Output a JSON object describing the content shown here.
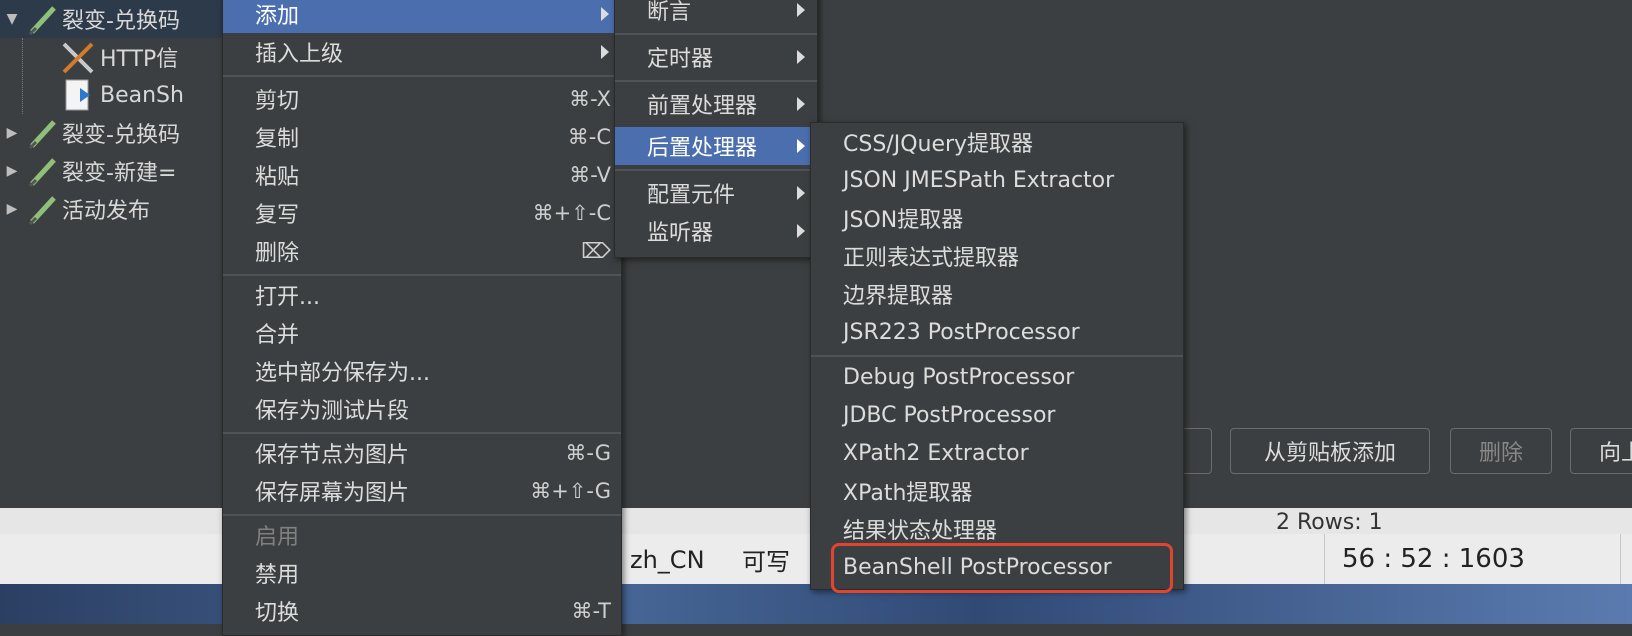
{
  "tree": {
    "items": [
      {
        "label": "裂变-兑换码",
        "expanded": true,
        "selected": true
      },
      {
        "label": "HTTP信",
        "child": true
      },
      {
        "label": "BeanSh",
        "child": true
      },
      {
        "label": "裂变-兑换码",
        "expanded": false
      },
      {
        "label": "裂变-新建=",
        "expanded": false
      },
      {
        "label": "活动发布",
        "expanded": false
      }
    ]
  },
  "buttons": {
    "paste_add": "从剪贴板添加",
    "delete": "删除",
    "up": "向上"
  },
  "bottom": {
    "rows_label": "2  Rows: 1"
  },
  "status": {
    "locale": "zh_CN",
    "writable": "可写",
    "position": "56 : 52 : 1603"
  },
  "context_menu": {
    "items": [
      {
        "label": "添加",
        "submenu": true,
        "highlighted": true
      },
      {
        "label": "插入上级",
        "submenu": true
      },
      {
        "label": "剪切",
        "shortcut": "⌘-X"
      },
      {
        "label": "复制",
        "shortcut": "⌘-C"
      },
      {
        "label": "粘贴",
        "shortcut": "⌘-V"
      },
      {
        "label": "复写",
        "shortcut": "⌘+⇧-C"
      },
      {
        "label": "删除",
        "shortcut": "⌦"
      },
      {
        "label": "打开..."
      },
      {
        "label": "合并"
      },
      {
        "label": "选中部分保存为..."
      },
      {
        "label": "保存为测试片段"
      },
      {
        "label": "保存节点为图片",
        "shortcut": "⌘-G"
      },
      {
        "label": "保存屏幕为图片",
        "shortcut": "⌘+⇧-G"
      },
      {
        "label": "启用",
        "disabled": true
      },
      {
        "label": "禁用"
      },
      {
        "label": "切换",
        "shortcut": "⌘-T"
      }
    ]
  },
  "add_submenu": {
    "items": [
      {
        "label": "断言"
      },
      {
        "label": "定时器"
      },
      {
        "label": "前置处理器"
      },
      {
        "label": "后置处理器",
        "highlighted": true
      },
      {
        "label": "配置元件"
      },
      {
        "label": "监听器"
      }
    ]
  },
  "postprocessor_submenu": {
    "items": [
      {
        "label": "CSS/JQuery提取器"
      },
      {
        "label": "JSON JMESPath Extractor"
      },
      {
        "label": "JSON提取器"
      },
      {
        "label": "正则表达式提取器"
      },
      {
        "label": "边界提取器"
      },
      {
        "label": "JSR223 PostProcessor"
      },
      {
        "label": "Debug PostProcessor"
      },
      {
        "label": "JDBC PostProcessor"
      },
      {
        "label": "XPath2 Extractor"
      },
      {
        "label": "XPath提取器"
      },
      {
        "label": "结果状态处理器"
      },
      {
        "label": "BeanShell PostProcessor",
        "annotated": true
      }
    ]
  },
  "colors": {
    "menu_bg": "#3c3f41",
    "highlight": "#4b6eaf",
    "annotation": "#e0452f"
  }
}
